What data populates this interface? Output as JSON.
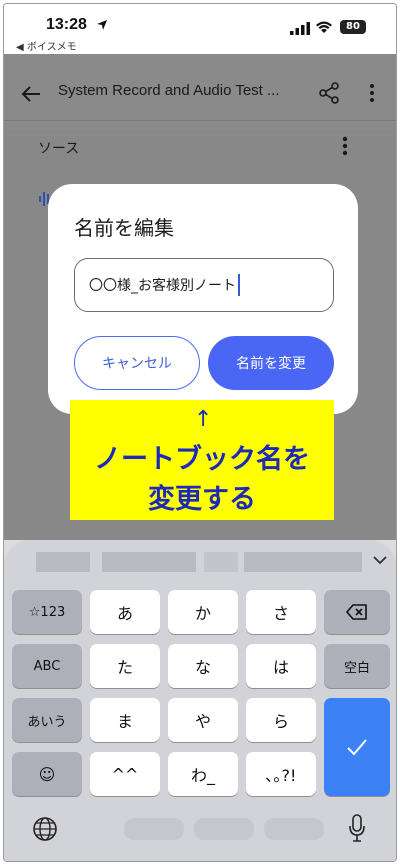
{
  "status_bar": {
    "time": "13:28",
    "back_app": "◀ ボイスメモ",
    "battery": "80"
  },
  "app_bar": {
    "title": "System Record and Audio Test ..."
  },
  "content": {
    "source_label": "ソース"
  },
  "dialog": {
    "title": "名前を編集",
    "input_value": "〇〇様_お客様別ノート",
    "cancel_label": "キャンセル",
    "rename_label": "名前を変更"
  },
  "annotation": {
    "arrow": "↑",
    "text": "ノートブック名を\n変更する"
  },
  "keyboard": {
    "keys": {
      "num": "☆123",
      "a": "あ",
      "ka": "か",
      "sa": "さ",
      "abc": "ABC",
      "ta": "た",
      "na": "な",
      "ha": "は",
      "space": "空白",
      "aiu": "あいう",
      "ma": "ま",
      "ya": "や",
      "ra": "ら",
      "emoji": "☺",
      "caret_face": "^^",
      "wa": "わ_",
      "punct": "､｡?!",
      "enter": "✓"
    }
  },
  "colors": {
    "accent_blue": "#4966f5",
    "enter_blue": "#3c82f6",
    "annotation_yellow": "#ffff00",
    "annotation_text": "#1b2ab8"
  }
}
